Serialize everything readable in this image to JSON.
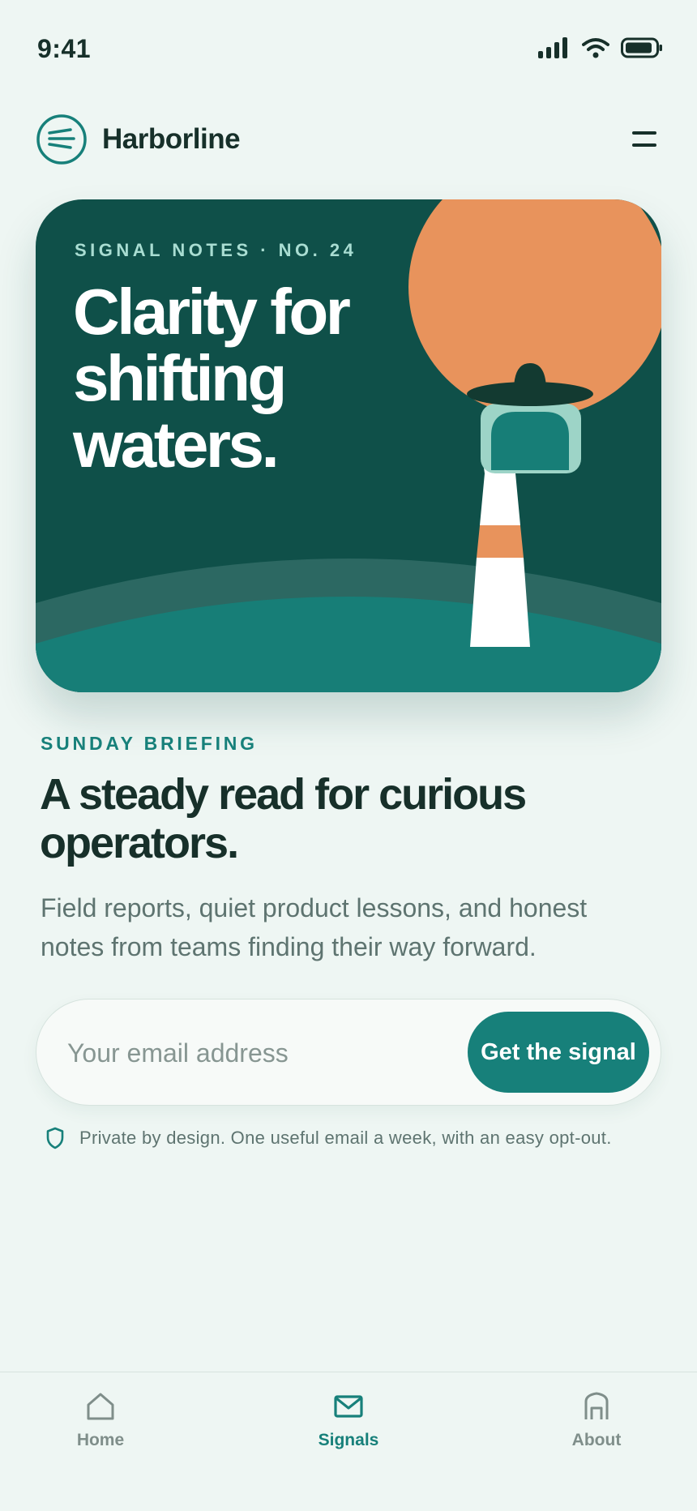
{
  "status_bar": {
    "time": "9:41"
  },
  "header": {
    "brand": "Harborline"
  },
  "hero": {
    "kicker": "SIGNAL NOTES · NO. 24",
    "title": "Clarity for shifting waters."
  },
  "main": {
    "eyebrow": "SUNDAY BRIEFING",
    "headline": "A steady read for curious operators.",
    "subcopy": "Field reports, quiet product lessons, and honest notes from teams finding their way forward."
  },
  "signup": {
    "email_placeholder": "Your email address",
    "email_value": "",
    "button_label": "Get the signal",
    "privacy_note": "Private by design. One useful email a week, with an easy opt-out."
  },
  "tab_bar": {
    "tabs": [
      {
        "label": "Home",
        "icon": "home-icon",
        "active": false
      },
      {
        "label": "Signals",
        "icon": "mail-icon",
        "active": true
      },
      {
        "label": "About",
        "icon": "building-icon",
        "active": false
      }
    ]
  },
  "colors": {
    "background": "#eef6f3",
    "accent": "#17807a",
    "hero_dark": "#0f5049",
    "sun": "#e8935c",
    "ink": "#17302a"
  }
}
